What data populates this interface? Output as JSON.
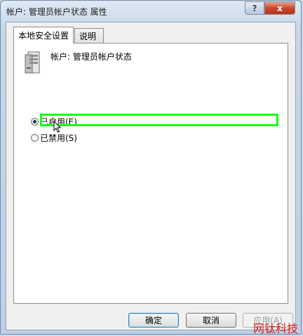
{
  "window": {
    "title": "帐户: 管理员帐户状态 属性",
    "help_glyph": "?",
    "close_glyph": "x"
  },
  "tabs": [
    {
      "label": "本地安全设置",
      "active": true
    },
    {
      "label": "说明",
      "active": false
    }
  ],
  "policy": {
    "label": "帐户: 管理员帐户状态"
  },
  "options": [
    {
      "label": "已启用(E)",
      "checked": true
    },
    {
      "label": "已禁用(S)",
      "checked": false
    }
  ],
  "buttons": {
    "ok": "确定",
    "cancel": "取消",
    "apply": "应用(A)"
  },
  "watermark": "网钛科技",
  "colors": {
    "highlight": "#12ff12",
    "close_button": "#c7492c",
    "watermark": "#d81e1e"
  }
}
